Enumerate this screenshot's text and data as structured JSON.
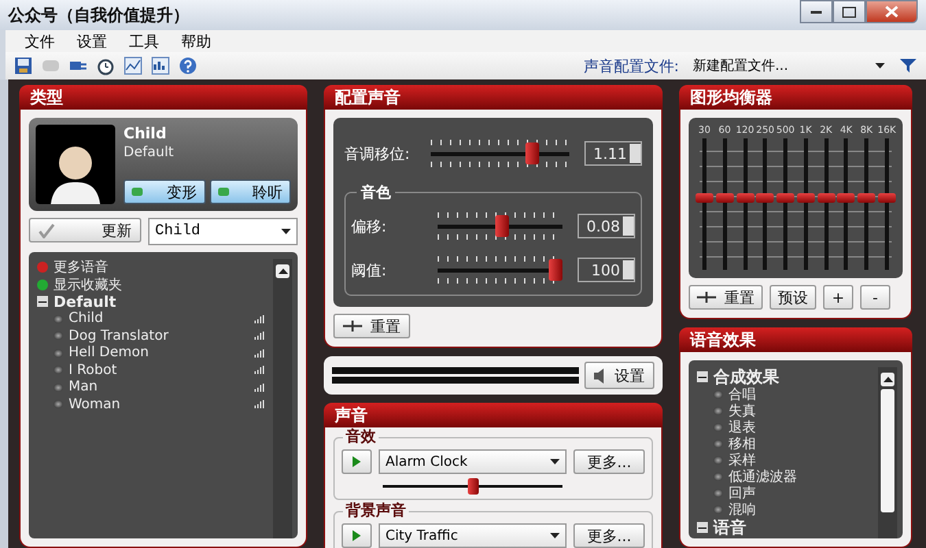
{
  "window": {
    "title": "公众号（自我价值提升）"
  },
  "menu": [
    "文件",
    "设置",
    "工具",
    "帮助"
  ],
  "toolbar": {
    "profile_label": "声音配置文件:",
    "profile_value": "新建配置文件..."
  },
  "type_panel": {
    "title": "类型",
    "voice_name": "Child",
    "voice_sub": "Default",
    "buttons": [
      "变形",
      "聆听"
    ],
    "update_button": "更新",
    "voice_select": "Child",
    "tree": [
      {
        "label": "更多语音",
        "kind": "link",
        "color": "#cc2222"
      },
      {
        "label": "显示收藏夹",
        "kind": "link",
        "color": "#22aa33"
      },
      {
        "label": "Default",
        "kind": "group",
        "expanded": true,
        "children": [
          {
            "label": "Child"
          },
          {
            "label": "Dog Translator"
          },
          {
            "label": "Hell Demon"
          },
          {
            "label": "I Robot"
          },
          {
            "label": "Man"
          },
          {
            "label": "Woman"
          }
        ]
      }
    ]
  },
  "config_panel": {
    "title": "配置声音",
    "sliders": [
      {
        "label": "音调移位:",
        "level": 0.76,
        "value": "1.11"
      }
    ],
    "timbre": {
      "title": "音色",
      "sliders": [
        {
          "label": "偏移:",
          "level": 0.52,
          "value": "0.08"
        },
        {
          "label": "阈值:",
          "level": 1,
          "value": "100"
        }
      ]
    },
    "reset_button": "重置"
  },
  "waveform": {
    "settings_button": "设置"
  },
  "sound_panel": {
    "title": "声音",
    "groups": [
      {
        "title": "音效",
        "select": "Alarm Clock",
        "more": "更多...",
        "level": 0.5
      },
      {
        "title": "背景声音",
        "select": "City Traffic",
        "more": "更多..."
      }
    ]
  },
  "equalizer": {
    "title": "图形均衡器",
    "bands": [
      {
        "label": "30",
        "level": 0.5
      },
      {
        "label": "60",
        "level": 0.5
      },
      {
        "label": "120",
        "level": 0.5
      },
      {
        "label": "250",
        "level": 0.5
      },
      {
        "label": "500",
        "level": 0.5
      },
      {
        "label": "1K",
        "level": 0.5
      },
      {
        "label": "2K",
        "level": 0.5
      },
      {
        "label": "4K",
        "level": 0.5
      },
      {
        "label": "8K",
        "level": 0.5
      },
      {
        "label": "16K",
        "level": 0.5
      }
    ],
    "reset_button": "重置",
    "preset_button": "预设",
    "add_button": "+",
    "remove_button": "-"
  },
  "effects_panel": {
    "title": "语音效果",
    "tree": [
      {
        "label": "合成效果",
        "expanded": true,
        "children": [
          {
            "label": "合唱"
          },
          {
            "label": "失真"
          },
          {
            "label": "退表"
          },
          {
            "label": "移相"
          },
          {
            "label": "采样"
          },
          {
            "label": "低通滤波器"
          },
          {
            "label": "回声"
          },
          {
            "label": "混响"
          }
        ]
      },
      {
        "label": "语音",
        "expanded": true
      }
    ]
  }
}
